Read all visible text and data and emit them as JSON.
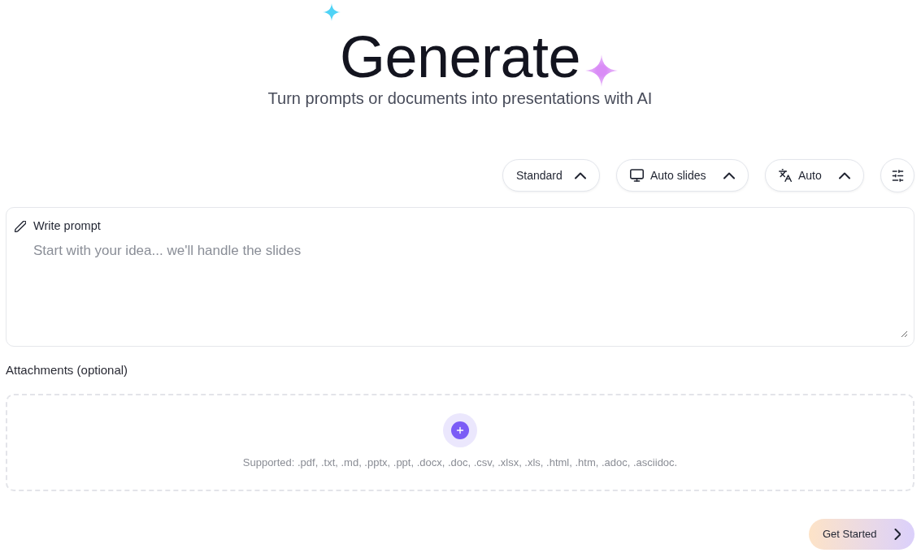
{
  "header": {
    "title": "Generate",
    "subtitle": "Turn prompts or documents into presentations with AI"
  },
  "options": [
    {
      "kind": "format",
      "label": "Standard"
    },
    {
      "kind": "slides",
      "label": "Auto slides"
    },
    {
      "kind": "language",
      "label": "Auto"
    }
  ],
  "prompt": {
    "label": "Write prompt",
    "placeholder": "Start with your idea... we'll handle the slides"
  },
  "attachments": {
    "label": "Attachments (optional)",
    "supported": "Supported: .pdf, .txt, .md, .pptx, .ppt, .docx, .doc, .csv, .xlsx, .xls, .html, .htm, .adoc, .asciidoc."
  },
  "primary_button": {
    "label": "Get Started"
  }
}
